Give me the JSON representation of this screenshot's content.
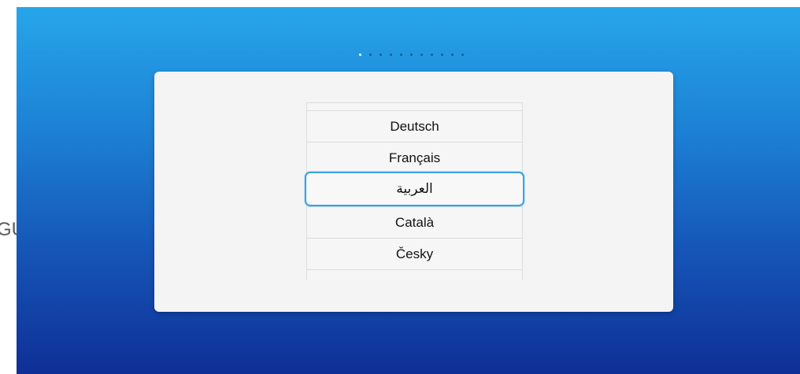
{
  "background_text": "GU",
  "pagination": {
    "total": 11,
    "active_index": 0
  },
  "language_picker": {
    "items": [
      {
        "label": "Deutsch",
        "selected": false
      },
      {
        "label": "Français",
        "selected": false
      },
      {
        "label": "العربية",
        "selected": true
      },
      {
        "label": "Català",
        "selected": false
      },
      {
        "label": "Česky",
        "selected": false
      }
    ]
  },
  "colors": {
    "gradient_top": "#27a6ea",
    "gradient_bottom": "#0e2f96",
    "selection_border": "#3aa3e6",
    "card_background": "#f4f4f4"
  }
}
